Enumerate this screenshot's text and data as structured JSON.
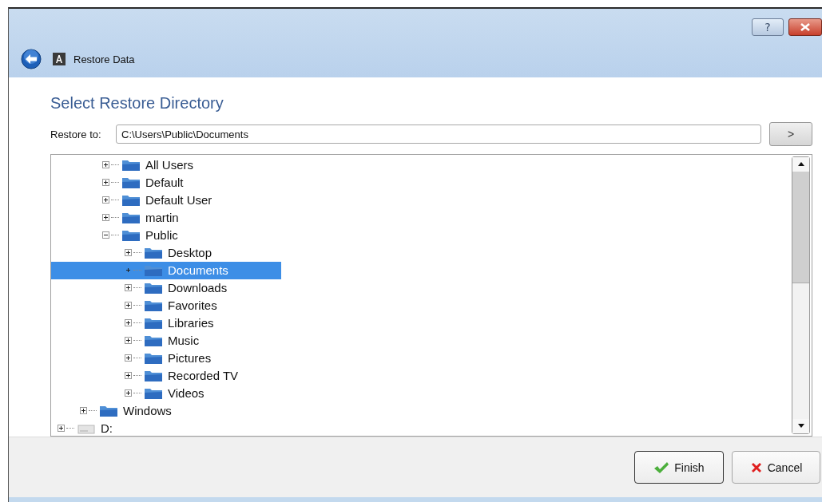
{
  "window": {
    "title": "Restore Data",
    "buttons": [
      {
        "kind": "help",
        "label": "?"
      },
      {
        "kind": "close"
      }
    ]
  },
  "heading": "Select Restore Directory",
  "restore_to": {
    "label": "Restore to:",
    "value": "C:\\Users\\Public\\Documents",
    "go_label": ">"
  },
  "tree": {
    "items": [
      {
        "children": [
          {
            "children": [
              {
                "label": "All Users",
                "kind": "folder",
                "expanded": false,
                "selected": false
              },
              {
                "label": "Default",
                "kind": "folder",
                "expanded": false,
                "selected": false
              },
              {
                "label": "Default User",
                "kind": "folder",
                "expanded": false,
                "selected": false
              },
              {
                "label": "martin",
                "kind": "folder",
                "expanded": false,
                "selected": false
              },
              {
                "label": "Public",
                "kind": "folder",
                "expanded": true,
                "selected": false,
                "children": [
                  {
                    "label": "Desktop",
                    "kind": "folder",
                    "expanded": false,
                    "selected": false
                  },
                  {
                    "label": "Documents",
                    "kind": "folder",
                    "expanded": false,
                    "selected": true
                  },
                  {
                    "label": "Downloads",
                    "kind": "folder",
                    "expanded": false,
                    "selected": false
                  },
                  {
                    "label": "Favorites",
                    "kind": "folder",
                    "expanded": false,
                    "selected": false
                  },
                  {
                    "label": "Libraries",
                    "kind": "folder",
                    "expanded": false,
                    "selected": false
                  },
                  {
                    "label": "Music",
                    "kind": "folder",
                    "expanded": false,
                    "selected": false
                  },
                  {
                    "label": "Pictures",
                    "kind": "folder",
                    "expanded": false,
                    "selected": false
                  },
                  {
                    "label": "Recorded TV",
                    "kind": "folder",
                    "expanded": false,
                    "selected": false
                  },
                  {
                    "label": "Videos",
                    "kind": "folder",
                    "expanded": false,
                    "selected": false
                  }
                ]
              }
            ]
          },
          {
            "label": "Windows",
            "kind": "folder",
            "expanded": false,
            "selected": false
          }
        ]
      },
      {
        "label": "D:",
        "kind": "drive",
        "expanded": false,
        "selected": false
      }
    ]
  },
  "buttons": [
    {
      "kind": "finish",
      "label": "Finish"
    },
    {
      "kind": "cancel",
      "label": "Cancel"
    }
  ]
}
